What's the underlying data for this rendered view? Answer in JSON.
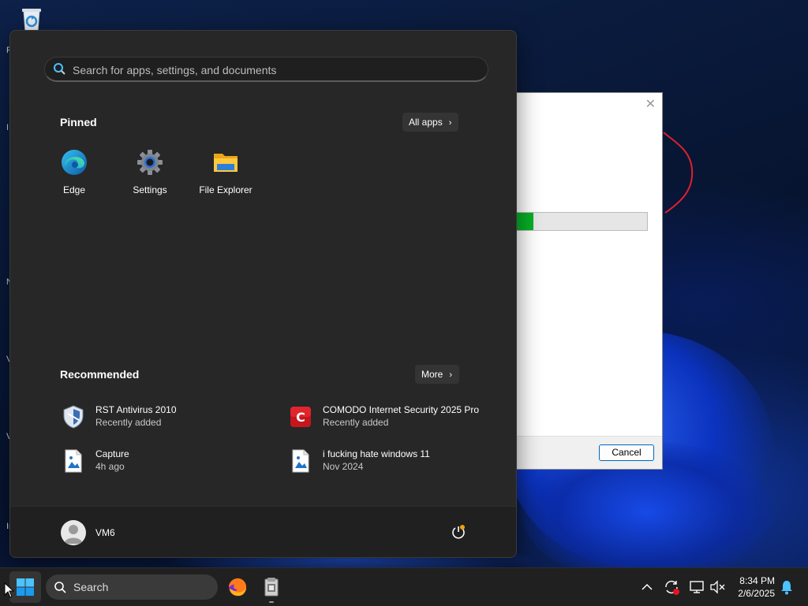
{
  "start_menu": {
    "search": {
      "placeholder": "Search for apps, settings, and documents"
    },
    "pinned": {
      "title": "Pinned",
      "all_apps_label": "All apps",
      "apps": [
        {
          "label": "Edge",
          "icon": "edge-icon"
        },
        {
          "label": "Settings",
          "icon": "settings-gear-icon"
        },
        {
          "label": "File Explorer",
          "icon": "folder-icon"
        }
      ]
    },
    "recommended": {
      "title": "Recommended",
      "more_label": "More",
      "items": [
        {
          "name": "RST Antivirus 2010",
          "detail": "Recently added",
          "icon": "shield-icon"
        },
        {
          "name": "COMODO Internet Security 2025 Pro",
          "detail": "Recently added",
          "icon": "comodo-icon"
        },
        {
          "name": "Capture",
          "detail": "4h ago",
          "icon": "image-file-icon"
        },
        {
          "name": "i fucking hate windows 11",
          "detail": "Nov 2024",
          "icon": "image-file-icon"
        }
      ]
    },
    "user": {
      "name": "VM6"
    },
    "power_icon": "power-icon"
  },
  "dialog": {
    "close_glyph": "✕",
    "progress_fraction": 0.13,
    "cancel_label": "Cancel"
  },
  "taskbar": {
    "search_label": "Search",
    "apps": [
      "firefox-icon",
      "installer-icon"
    ],
    "tray_icons": [
      "chevron-up-icon",
      "sync-icon",
      "network-icon",
      "volume-muted-icon",
      "notification-bell-icon"
    ],
    "time": "8:34 PM",
    "date": "2/6/2025"
  },
  "desktop": {
    "icon_letters": [
      "R",
      "I",
      "N",
      "V",
      "V",
      "In"
    ]
  },
  "colors": {
    "accent": "#0067c0",
    "progress_green": "#06b025",
    "start_bg": "#272727",
    "taskbar_bg": "#202020"
  }
}
